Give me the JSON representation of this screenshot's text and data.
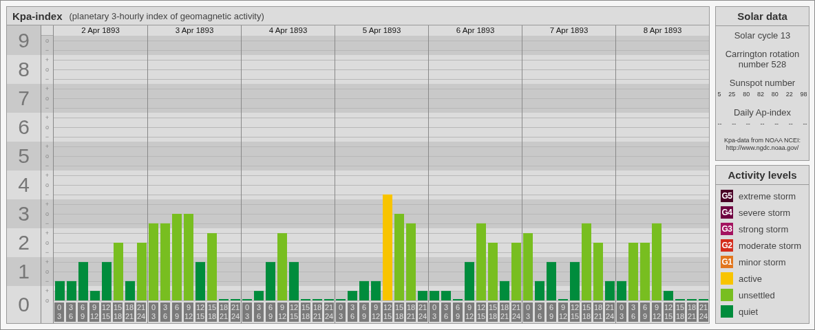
{
  "title": {
    "name": "Kpa-index",
    "subtitle": "(planetary 3-hourly index of geomagnetic activity)"
  },
  "kp_chart": {
    "dates": [
      "2 Apr 1893",
      "3 Apr 1893",
      "4 Apr 1893",
      "5 Apr 1893",
      "6 Apr 1893",
      "7 Apr 1893",
      "8 Apr 1893"
    ],
    "minor_marks": [
      [
        "o",
        "−"
      ],
      [
        "+",
        "o",
        "−"
      ],
      [
        "+",
        "o",
        "−"
      ],
      [
        "+",
        "o",
        "−"
      ],
      [
        "+",
        "o",
        "−"
      ],
      [
        "+",
        "o",
        "−"
      ],
      [
        "+",
        "o",
        "−"
      ],
      [
        "+",
        "o",
        "−"
      ],
      [
        "+",
        "o",
        "−"
      ],
      [
        "+",
        "o"
      ]
    ],
    "chart_data": {
      "type": "bar",
      "ylim": [
        0,
        9
      ],
      "yticks": [
        {
          "value": 0,
          "label": "0"
        },
        {
          "value": 1,
          "label": "1"
        },
        {
          "value": 2,
          "label": "2"
        },
        {
          "value": 3,
          "label": "3"
        },
        {
          "value": 4,
          "label": "4"
        },
        {
          "value": 5,
          "label": "5"
        },
        {
          "value": 6,
          "label": "6"
        },
        {
          "value": 7,
          "label": "7"
        },
        {
          "value": 8,
          "label": "8"
        },
        {
          "value": 9,
          "label": "9"
        }
      ],
      "grid": true,
      "categories": [
        "0\n3",
        "3\n6",
        "6\n9",
        "9\n12",
        "12\n15",
        "15\n18",
        "18\n21",
        "21\n24",
        "0\n3",
        "3\n6",
        "6\n9",
        "9\n12",
        "12\n15",
        "15\n18",
        "18\n21",
        "21\n24",
        "0\n3",
        "3\n6",
        "6\n9",
        "9\n12",
        "12\n15",
        "15\n18",
        "18\n21",
        "21\n24",
        "0\n3",
        "3\n6",
        "6\n9",
        "9\n12",
        "12\n15",
        "15\n18",
        "18\n21",
        "21\n24",
        "0\n3",
        "3\n6",
        "6\n9",
        "9\n12",
        "12\n15",
        "15\n18",
        "18\n21",
        "21\n24",
        "0\n3",
        "3\n6",
        "6\n9",
        "9\n12",
        "12\n15",
        "15\n18",
        "18\n21",
        "21\n24",
        "0\n3",
        "3\n6",
        "6\n9",
        "9\n12",
        "12\n15",
        "15\n18",
        "18\n21",
        "21\n24"
      ],
      "series": [
        {
          "values": [
            0.67,
            0.67,
            1.33,
            0.33,
            1.33,
            2,
            0.67,
            2,
            2.67,
            2.67,
            3,
            3,
            1.33,
            2.33,
            0,
            0,
            0,
            0.33,
            1.33,
            2.33,
            1.33,
            0,
            0,
            0,
            0,
            0.33,
            0.67,
            0.67,
            3.67,
            3,
            2.67,
            0.33,
            0.33,
            0.33,
            0,
            1.33,
            2.67,
            2,
            0.67,
            2,
            2.33,
            0.67,
            1.33,
            0,
            1.33,
            2.67,
            2,
            0.67,
            0.67,
            2,
            2,
            2.67,
            0.33,
            0,
            0,
            0
          ]
        }
      ]
    }
  },
  "solar_data": {
    "title": "Solar data",
    "solar_cycle": "Solar cycle 13",
    "carrington": "Carrington rotation number 528",
    "sunspot_label": "Sunspot number",
    "sunspot_values": [
      "5",
      "25",
      "80",
      "82",
      "80",
      "22",
      "98"
    ],
    "ap_label": "Daily Ap-index",
    "ap_values": [
      "--",
      "--",
      "--",
      "--",
      "--",
      "--",
      "--"
    ],
    "credit": "Kpa-data from NOAA NCEI:",
    "credit_url": "http://www.ngdc.noaa.gov/"
  },
  "activity_levels": {
    "title": "Activity levels",
    "items": [
      {
        "badge": "G5",
        "label": "extreme storm",
        "color": "#4a0026"
      },
      {
        "badge": "G4",
        "label": "severe storm",
        "color": "#6e0040"
      },
      {
        "badge": "G3",
        "label": "strong storm",
        "color": "#a3135f"
      },
      {
        "badge": "G2",
        "label": "moderate storm",
        "color": "#d42c1c"
      },
      {
        "badge": "G1",
        "label": "minor storm",
        "color": "#e2761e"
      },
      {
        "label": "active",
        "color": "#f8c400"
      },
      {
        "label": "unsettled",
        "color": "#78be20"
      },
      {
        "label": "quiet",
        "color": "#008c3c"
      }
    ]
  }
}
